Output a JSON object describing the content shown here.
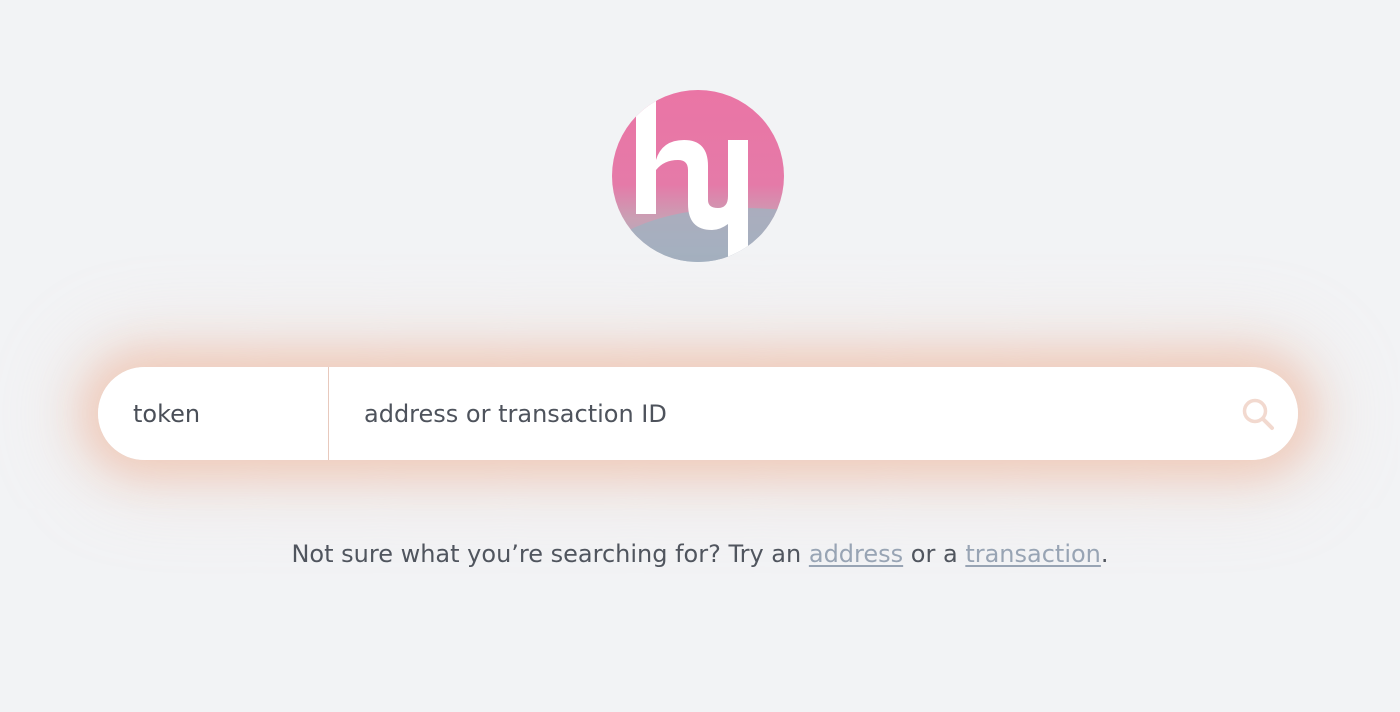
{
  "logo": {
    "icon": "hy-logo-icon",
    "colors": {
      "pink": "#ea75a5",
      "gray": "#a3b0bf"
    }
  },
  "search": {
    "type_label": "token",
    "placeholder": "address or transaction ID",
    "button_icon": "search-icon",
    "accent": "#f2d9cf"
  },
  "hint": {
    "prefix": "Not sure what you’re searching for? Try an ",
    "link_address": "address",
    "middle": " or a ",
    "link_transaction": "transaction",
    "suffix": "."
  }
}
